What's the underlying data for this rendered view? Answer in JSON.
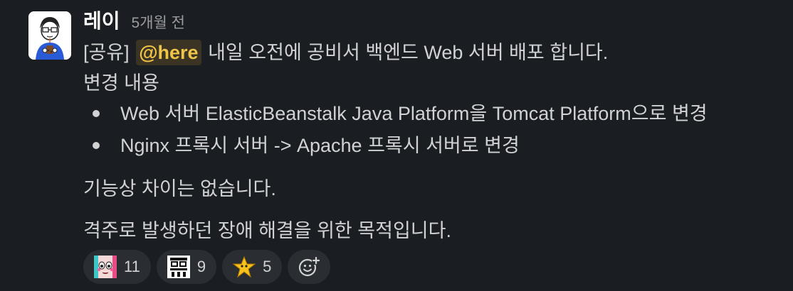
{
  "message": {
    "sender": "레이",
    "timestamp": "5개월 전",
    "line1_prefix": "[공유]",
    "mention": "@here",
    "line1_suffix": "내일 오전에 공비서 백엔드 Web 서버 배포 합니다.",
    "line2": "변경 내용",
    "bullets": [
      "Web 서버 ElasticBeanstalk Java Platform을 Tomcat Platform으로 변경",
      "Nginx 프록시 서버 -> Apache 프록시 서버로 변경"
    ],
    "line3": "기능상 차이는 없습니다.",
    "line4": "격주로 발생하던 장애 해결을 위한 목적입니다."
  },
  "reactions": [
    {
      "emoji": "face-emoji",
      "count": "11"
    },
    {
      "emoji": "text-sticker-emoji",
      "count": "9"
    },
    {
      "emoji": "star-emoji",
      "count": "5"
    }
  ],
  "add_reaction_icon": "add-reaction-icon",
  "colors": {
    "background": "#1a1d21",
    "text": "#d1d2d3",
    "mention_bg": "#3b3424",
    "mention_text": "#f0c446",
    "reaction_bg": "#2a2d31"
  }
}
